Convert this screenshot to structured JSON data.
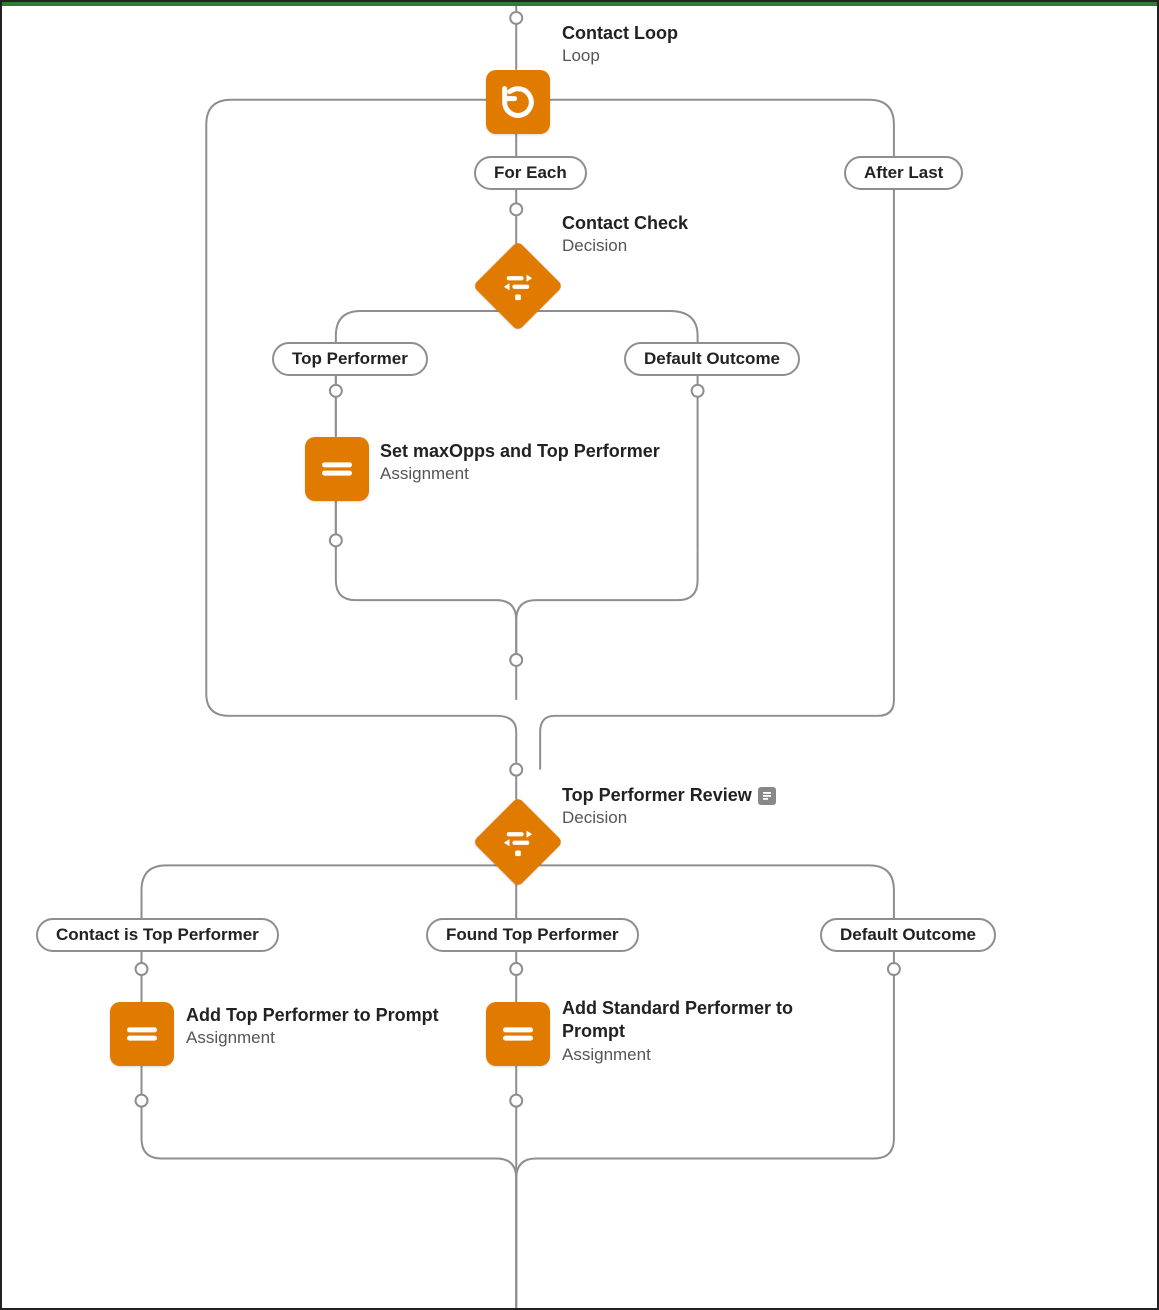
{
  "nodes": {
    "contact_loop": {
      "title": "Contact Loop",
      "type": "Loop"
    },
    "contact_check": {
      "title": "Contact Check",
      "type": "Decision"
    },
    "set_max": {
      "title": "Set maxOpps and Top Performer",
      "type": "Assignment"
    },
    "review": {
      "title": "Top Performer Review",
      "type": "Decision"
    },
    "add_top": {
      "title": "Add Top Performer to Prompt",
      "type": "Assignment"
    },
    "add_std": {
      "title": "Add Standard Performer to Prompt",
      "type": "Assignment"
    }
  },
  "branches": {
    "for_each": "For Each",
    "after_last": "After Last",
    "top_performer": "Top Performer",
    "default_outcome": "Default Outcome",
    "contact_is_top": "Contact is Top Performer",
    "found_top": "Found Top Performer",
    "default_outcome_2": "Default Outcome"
  },
  "colors": {
    "node_bg": "#e07b00",
    "line": "#8e8e8e"
  }
}
